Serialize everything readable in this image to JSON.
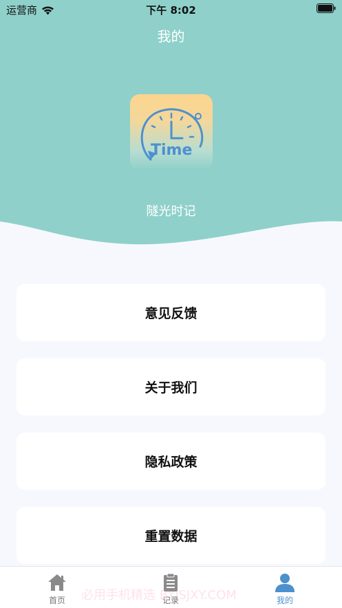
{
  "status_bar": {
    "carrier": "运营商",
    "time": "下午 8:02"
  },
  "header": {
    "title": "我的",
    "app_name": "隧光时记",
    "logo_text": "Time"
  },
  "menu": [
    {
      "label": "意见反馈"
    },
    {
      "label": "关于我们"
    },
    {
      "label": "隐私政策"
    },
    {
      "label": "重置数据"
    }
  ],
  "tabbar": {
    "tabs": [
      {
        "label": "首页",
        "icon": "home-icon"
      },
      {
        "label": "记录",
        "icon": "clipboard-icon"
      },
      {
        "label": "我的",
        "icon": "user-icon",
        "active": true
      }
    ]
  },
  "watermark": "必用手机精选 BYJSJXY.COM",
  "colors": {
    "header_teal": "#8fd0ca",
    "accent_blue": "#4d90ce",
    "background": "#f7f8fd"
  }
}
